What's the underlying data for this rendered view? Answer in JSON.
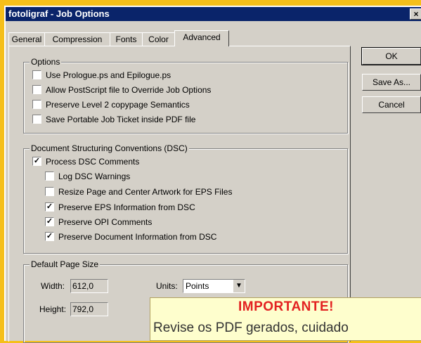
{
  "window": {
    "title": "fotoligraf - Job Options",
    "close_glyph": "×"
  },
  "tabs": [
    "General",
    "Compression",
    "Fonts",
    "Color",
    "Advanced"
  ],
  "buttons": {
    "ok": "OK",
    "save_as": "Save As...",
    "cancel": "Cancel"
  },
  "options": {
    "legend": "Options",
    "items": [
      {
        "label": "Use Prologue.ps and Epilogue.ps",
        "checked": false
      },
      {
        "label": "Allow PostScript file to Override Job Options",
        "checked": false
      },
      {
        "label": "Preserve Level 2 copypage Semantics",
        "checked": false
      },
      {
        "label": "Save Portable Job Ticket inside PDF file",
        "checked": false
      }
    ]
  },
  "dsc": {
    "legend": "Document Structuring Conventions (DSC)",
    "items": [
      {
        "label": "Process DSC Comments",
        "checked": true
      },
      {
        "label": "Log DSC Warnings",
        "checked": false
      },
      {
        "label": "Resize Page and Center Artwork for EPS Files",
        "checked": false
      },
      {
        "label": "Preserve EPS Information from DSC",
        "checked": true
      },
      {
        "label": "Preserve OPI Comments",
        "checked": true
      },
      {
        "label": "Preserve Document Information from DSC",
        "checked": true
      }
    ]
  },
  "page_size": {
    "legend": "Default Page Size",
    "width_label": "Width:",
    "width_value": "612,0",
    "height_label": "Height:",
    "height_value": "792,0",
    "units_label": "Units:",
    "units_value": "Points"
  },
  "notice": {
    "heading": "IMPORTANTE!",
    "body": "Revise os PDF gerados, cuidado"
  }
}
